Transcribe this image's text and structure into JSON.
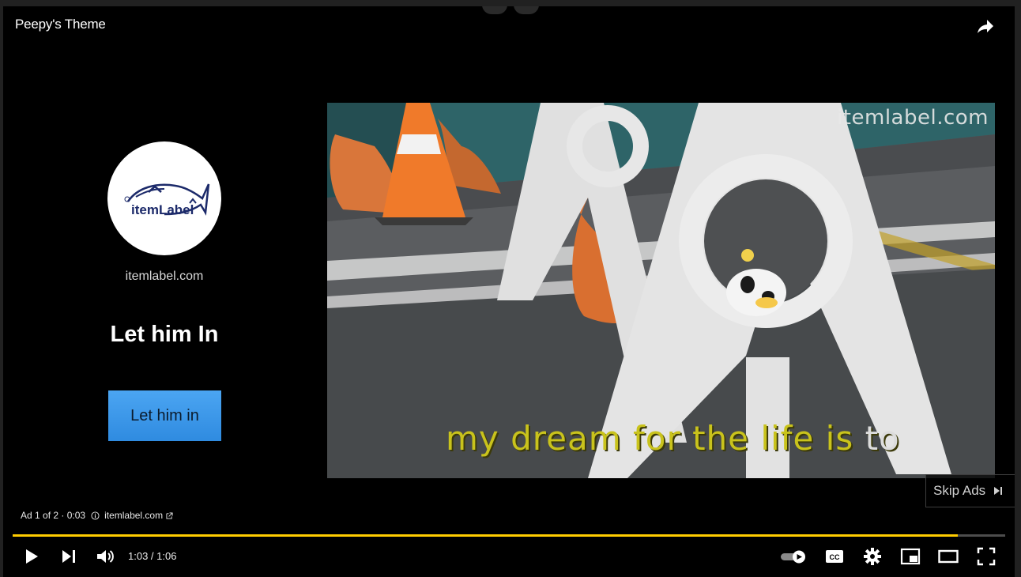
{
  "video": {
    "title": "Peepy's Theme",
    "watermark": "itemlabel.com",
    "subtitle_main": "my dream for the life is",
    "subtitle_tail": "to"
  },
  "advertiser": {
    "logo_text": "itemLabel",
    "domain": "itemlabel.com",
    "headline": "Let him In",
    "cta_label": "Let him in"
  },
  "skip": {
    "label": "Skip Ads"
  },
  "ad_info": {
    "counter": "Ad 1 of 2 · 0:03",
    "link": "itemlabel.com"
  },
  "player": {
    "current_time": "1:03",
    "duration": "1:06",
    "time_display": "1:03 / 1:06",
    "progress_fraction": 0.952,
    "accent_color": "#ffcc00"
  },
  "icons": [
    "share-icon",
    "play-icon",
    "next-icon",
    "volume-icon",
    "autoplay-toggle-icon",
    "captions-icon",
    "settings-icon",
    "miniplayer-icon",
    "theater-icon",
    "fullscreen-icon",
    "info-icon",
    "external-link-icon",
    "skip-icon"
  ]
}
